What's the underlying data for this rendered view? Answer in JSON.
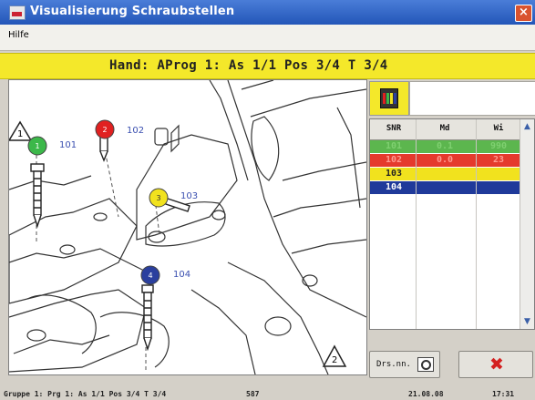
{
  "window": {
    "title": "Visualisierung Schraubstellen",
    "close_glyph": "×"
  },
  "menu": {
    "items": [
      "Hilfe"
    ]
  },
  "status_line": "Hand: AProg 1: As 1/1 Pos 3/4 T 3/4",
  "drawing": {
    "markers": [
      {
        "number": "1",
        "label": "101",
        "color": "#3cb84a"
      },
      {
        "number": "2",
        "label": "102",
        "color": "#e02020"
      },
      {
        "number": "3",
        "label": "103",
        "color": "#f1e21e"
      },
      {
        "number": "4",
        "label": "104",
        "color": "#2a3f9e"
      }
    ],
    "triangles": [
      "1",
      "2"
    ]
  },
  "table": {
    "headers": [
      "SNR",
      "Md",
      "Wi"
    ],
    "rows": [
      {
        "snr": "101",
        "md": "0.1",
        "wi": "990",
        "bg": "#5cb64e",
        "fg": "#7fd070"
      },
      {
        "snr": "102",
        "md": "0.0",
        "wi": "23",
        "bg": "#e53a2d",
        "fg": "#ff9a90"
      },
      {
        "snr": "103",
        "md": "",
        "wi": "",
        "bg": "#f1e21e",
        "fg": "#222222"
      },
      {
        "snr": "104",
        "md": "",
        "wi": "",
        "bg": "#1f3a9a",
        "fg": "#ffffff"
      }
    ]
  },
  "buttons": {
    "print": "Drs.nn.",
    "close_glyph": "✖"
  },
  "statusbar": {
    "left": "Gruppe 1: Prg 1: As 1/1 Pos 3/4 T 3/4",
    "code": "587",
    "date": "21.08.08",
    "time": "17:31"
  },
  "icons": {
    "app": "app-window-icon",
    "close": "close-icon",
    "toolbar": "bolt-sequence-icon",
    "print": "magnifier-icon",
    "cancel": "red-x-icon"
  }
}
